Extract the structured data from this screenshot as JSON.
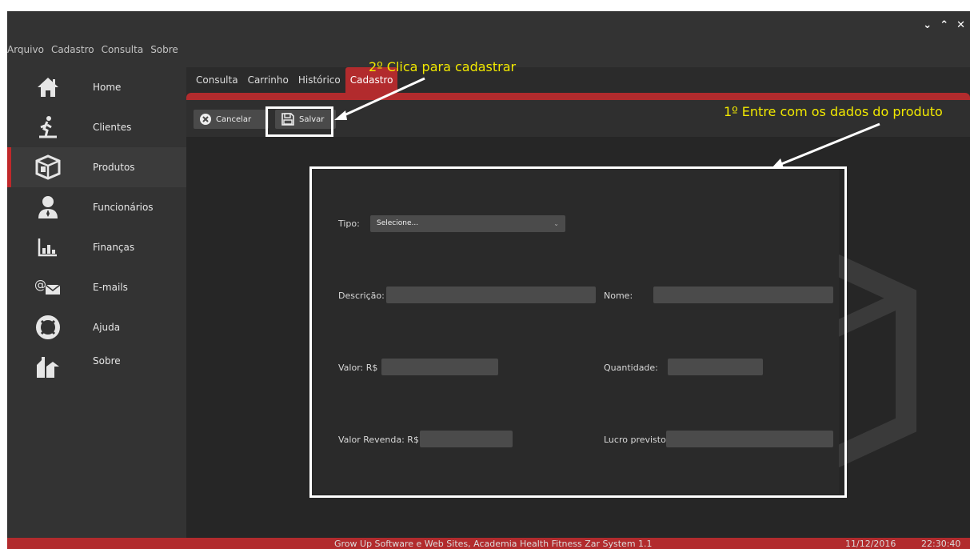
{
  "menubar": [
    "Arquivo",
    "Cadastro",
    "Consulta",
    "Sobre"
  ],
  "window_controls": {
    "minimize": "⌄",
    "maximize": "⌃",
    "close": "✕"
  },
  "sidebar": {
    "items": [
      {
        "label": "Home",
        "icon": "home-icon"
      },
      {
        "label": "Clientes",
        "icon": "runner-icon"
      },
      {
        "label": "Produtos",
        "icon": "box-icon",
        "active": true
      },
      {
        "label": "Funcionários",
        "icon": "employee-icon"
      },
      {
        "label": "Finanças",
        "icon": "bar-chart-icon"
      },
      {
        "label": "E-mails",
        "icon": "email-icon"
      },
      {
        "label": "Ajuda",
        "icon": "lifebuoy-icon"
      },
      {
        "label": "Sobre",
        "icon": "about-icon"
      }
    ]
  },
  "tabs": [
    {
      "label": "Consulta"
    },
    {
      "label": "Carrinho"
    },
    {
      "label": "Histórico"
    },
    {
      "label": "Cadastro",
      "active": true
    }
  ],
  "toolbar": {
    "cancel_label": "Cancelar",
    "save_label": "Salvar"
  },
  "form": {
    "tipo_label": "Tipo:",
    "tipo_value": "Selecione...",
    "descricao_label": "Descrição:",
    "nome_label": "Nome:",
    "valor_label": "Valor: R$",
    "quantidade_label": "Quantidade:",
    "valor_revenda_label": "Valor Revenda: R$",
    "lucro_label": "Lucro previsto:"
  },
  "annotations": {
    "step2": "2º Clica para cadastrar",
    "step1": "1º Entre com os dados do produto"
  },
  "status": {
    "footer_text": "Grow Up Software e Web Sites, Academia Health Fitness Zar System 1.1",
    "date": "11/12/2016",
    "time": "22:30:40"
  },
  "colors": {
    "accent": "#b22b2d",
    "annotation": "#f2e900"
  }
}
